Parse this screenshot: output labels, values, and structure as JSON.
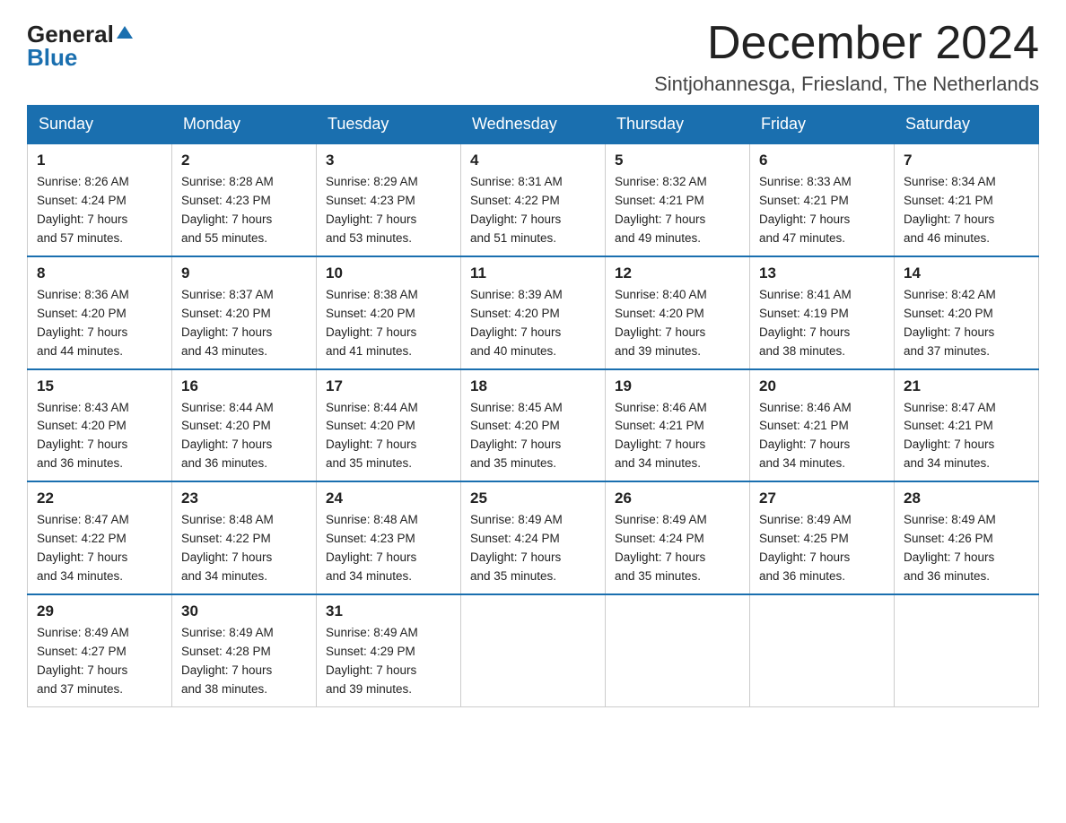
{
  "header": {
    "logo": {
      "general": "General",
      "blue": "Blue",
      "arrow": "▲"
    },
    "month_title": "December 2024",
    "location": "Sintjohannesga, Friesland, The Netherlands"
  },
  "weekdays": [
    "Sunday",
    "Monday",
    "Tuesday",
    "Wednesday",
    "Thursday",
    "Friday",
    "Saturday"
  ],
  "weeks": [
    [
      {
        "day": "1",
        "info": "Sunrise: 8:26 AM\nSunset: 4:24 PM\nDaylight: 7 hours\nand 57 minutes."
      },
      {
        "day": "2",
        "info": "Sunrise: 8:28 AM\nSunset: 4:23 PM\nDaylight: 7 hours\nand 55 minutes."
      },
      {
        "day": "3",
        "info": "Sunrise: 8:29 AM\nSunset: 4:23 PM\nDaylight: 7 hours\nand 53 minutes."
      },
      {
        "day": "4",
        "info": "Sunrise: 8:31 AM\nSunset: 4:22 PM\nDaylight: 7 hours\nand 51 minutes."
      },
      {
        "day": "5",
        "info": "Sunrise: 8:32 AM\nSunset: 4:21 PM\nDaylight: 7 hours\nand 49 minutes."
      },
      {
        "day": "6",
        "info": "Sunrise: 8:33 AM\nSunset: 4:21 PM\nDaylight: 7 hours\nand 47 minutes."
      },
      {
        "day": "7",
        "info": "Sunrise: 8:34 AM\nSunset: 4:21 PM\nDaylight: 7 hours\nand 46 minutes."
      }
    ],
    [
      {
        "day": "8",
        "info": "Sunrise: 8:36 AM\nSunset: 4:20 PM\nDaylight: 7 hours\nand 44 minutes."
      },
      {
        "day": "9",
        "info": "Sunrise: 8:37 AM\nSunset: 4:20 PM\nDaylight: 7 hours\nand 43 minutes."
      },
      {
        "day": "10",
        "info": "Sunrise: 8:38 AM\nSunset: 4:20 PM\nDaylight: 7 hours\nand 41 minutes."
      },
      {
        "day": "11",
        "info": "Sunrise: 8:39 AM\nSunset: 4:20 PM\nDaylight: 7 hours\nand 40 minutes."
      },
      {
        "day": "12",
        "info": "Sunrise: 8:40 AM\nSunset: 4:20 PM\nDaylight: 7 hours\nand 39 minutes."
      },
      {
        "day": "13",
        "info": "Sunrise: 8:41 AM\nSunset: 4:19 PM\nDaylight: 7 hours\nand 38 minutes."
      },
      {
        "day": "14",
        "info": "Sunrise: 8:42 AM\nSunset: 4:20 PM\nDaylight: 7 hours\nand 37 minutes."
      }
    ],
    [
      {
        "day": "15",
        "info": "Sunrise: 8:43 AM\nSunset: 4:20 PM\nDaylight: 7 hours\nand 36 minutes."
      },
      {
        "day": "16",
        "info": "Sunrise: 8:44 AM\nSunset: 4:20 PM\nDaylight: 7 hours\nand 36 minutes."
      },
      {
        "day": "17",
        "info": "Sunrise: 8:44 AM\nSunset: 4:20 PM\nDaylight: 7 hours\nand 35 minutes."
      },
      {
        "day": "18",
        "info": "Sunrise: 8:45 AM\nSunset: 4:20 PM\nDaylight: 7 hours\nand 35 minutes."
      },
      {
        "day": "19",
        "info": "Sunrise: 8:46 AM\nSunset: 4:21 PM\nDaylight: 7 hours\nand 34 minutes."
      },
      {
        "day": "20",
        "info": "Sunrise: 8:46 AM\nSunset: 4:21 PM\nDaylight: 7 hours\nand 34 minutes."
      },
      {
        "day": "21",
        "info": "Sunrise: 8:47 AM\nSunset: 4:21 PM\nDaylight: 7 hours\nand 34 minutes."
      }
    ],
    [
      {
        "day": "22",
        "info": "Sunrise: 8:47 AM\nSunset: 4:22 PM\nDaylight: 7 hours\nand 34 minutes."
      },
      {
        "day": "23",
        "info": "Sunrise: 8:48 AM\nSunset: 4:22 PM\nDaylight: 7 hours\nand 34 minutes."
      },
      {
        "day": "24",
        "info": "Sunrise: 8:48 AM\nSunset: 4:23 PM\nDaylight: 7 hours\nand 34 minutes."
      },
      {
        "day": "25",
        "info": "Sunrise: 8:49 AM\nSunset: 4:24 PM\nDaylight: 7 hours\nand 35 minutes."
      },
      {
        "day": "26",
        "info": "Sunrise: 8:49 AM\nSunset: 4:24 PM\nDaylight: 7 hours\nand 35 minutes."
      },
      {
        "day": "27",
        "info": "Sunrise: 8:49 AM\nSunset: 4:25 PM\nDaylight: 7 hours\nand 36 minutes."
      },
      {
        "day": "28",
        "info": "Sunrise: 8:49 AM\nSunset: 4:26 PM\nDaylight: 7 hours\nand 36 minutes."
      }
    ],
    [
      {
        "day": "29",
        "info": "Sunrise: 8:49 AM\nSunset: 4:27 PM\nDaylight: 7 hours\nand 37 minutes."
      },
      {
        "day": "30",
        "info": "Sunrise: 8:49 AM\nSunset: 4:28 PM\nDaylight: 7 hours\nand 38 minutes."
      },
      {
        "day": "31",
        "info": "Sunrise: 8:49 AM\nSunset: 4:29 PM\nDaylight: 7 hours\nand 39 minutes."
      },
      {
        "day": "",
        "info": ""
      },
      {
        "day": "",
        "info": ""
      },
      {
        "day": "",
        "info": ""
      },
      {
        "day": "",
        "info": ""
      }
    ]
  ]
}
